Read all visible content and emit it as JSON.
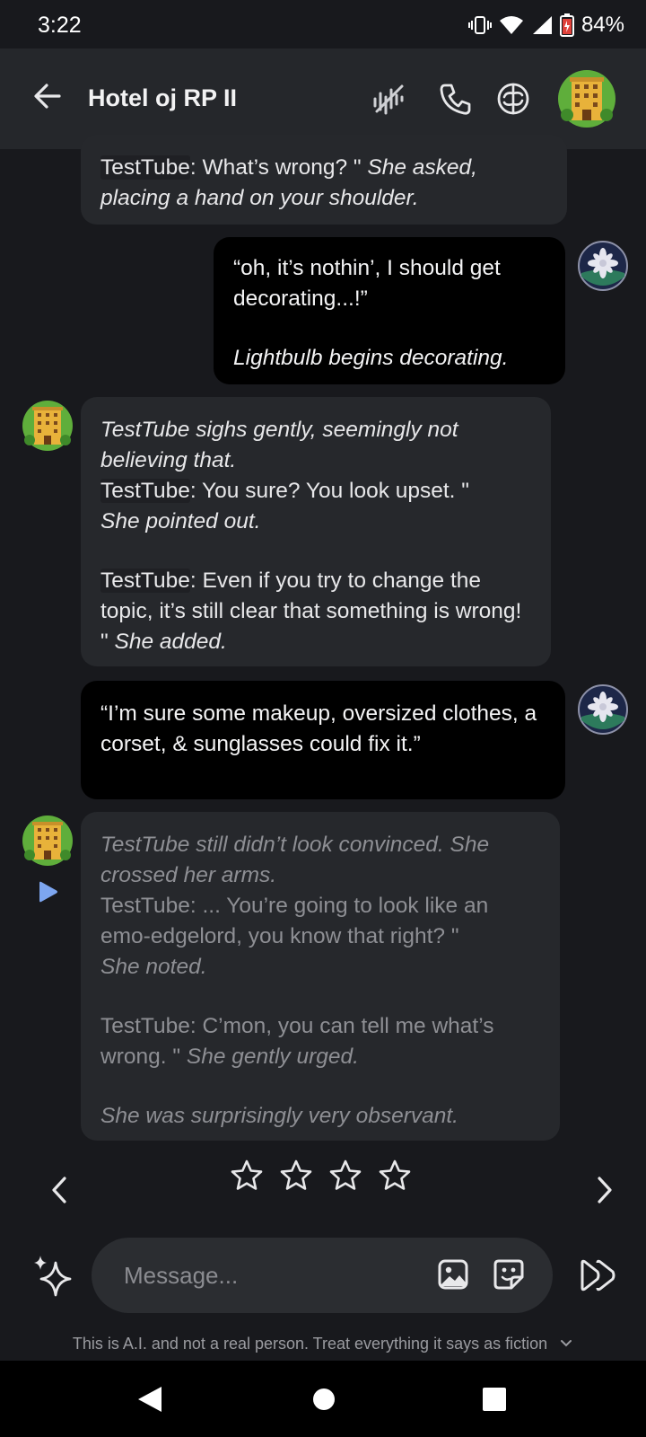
{
  "status": {
    "time": "3:22",
    "battery": "84%"
  },
  "header": {
    "title": "Hotel oj RP II"
  },
  "messages": {
    "m1": {
      "name": "TestTube",
      "text": ": What’s wrong? \" ",
      "action": "She asked, placing a hand on your shoulder."
    },
    "m2": {
      "line1": "“oh, it’s nothin’, I should get decorating...!”",
      "action": "Lightbulb begins decorating."
    },
    "m3": {
      "action1": "TestTube sighs gently, seemingly not believing that.",
      "name1": "TestTube",
      "text1": ": You sure? You look upset. \"",
      "action2": "She pointed out.",
      "name2": "TestTube",
      "text2": ": Even if you try to change the topic, it’s still clear that something is wrong! \" ",
      "action3": "She added."
    },
    "m4": {
      "text": "“I’m sure some makeup, oversized clothes, a corset, & sunglasses could fix it.”"
    },
    "m5": {
      "action1": "TestTube still didn’t look convinced. She crossed her arms.",
      "name1": "TestTube",
      "text1": ": ... You’re going to look like an emo-edgelord, you know that right? \"",
      "action2": "She noted.",
      "name2": "TestTube",
      "text2": ": C’mon, you can tell me what’s wrong. \" ",
      "action3": "She gently urged.",
      "action4": "She was surprisingly very observant."
    }
  },
  "rating": {
    "stars_filled": 0,
    "stars_total": 4
  },
  "composer": {
    "placeholder": "Message..."
  },
  "disclaimer": "This is A.I. and not a real person. Treat everything it says as fiction"
}
